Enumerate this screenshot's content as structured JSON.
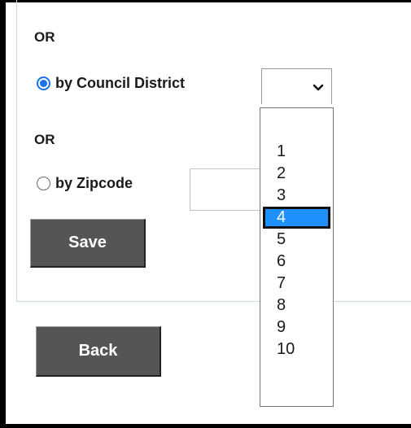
{
  "form": {
    "or_label_1": "OR",
    "council_radio_label": "by Council District",
    "council_radio_checked": true,
    "or_label_2": "OR",
    "zipcode_radio_label": "by Zipcode",
    "zipcode_radio_checked": false,
    "zipcode_value": "",
    "save_label": "Save",
    "back_label": "Back"
  },
  "district_select": {
    "selected_value": "",
    "options": [
      "1",
      "2",
      "3",
      "4",
      "5",
      "6",
      "7",
      "8",
      "9",
      "10"
    ],
    "highlighted_option": "4"
  },
  "colors": {
    "radio_accent": "#1a73e8",
    "highlight": "#1e90ff",
    "button_bg": "#555555"
  }
}
